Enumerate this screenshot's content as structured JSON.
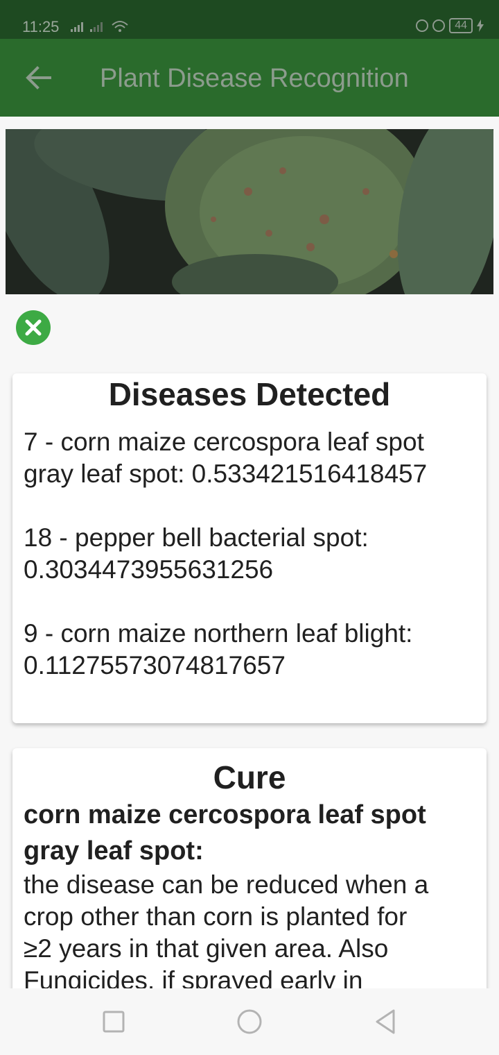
{
  "status_bar": {
    "time": "11:25",
    "battery": "44"
  },
  "app_bar": {
    "title": "Plant Disease Recognition"
  },
  "results_card": {
    "title": "Diseases Detected",
    "items": [
      {
        "line1": "7 - corn maize cercospora leaf spot",
        "line2": "gray leaf spot: 0.533421516418457"
      },
      {
        "line1": "18 - pepper bell bacterial spot:",
        "line2": "0.3034473955631256"
      },
      {
        "line1": "9 - corn maize northern leaf blight:",
        "line2": "0.11275573074817657"
      }
    ]
  },
  "cure_card": {
    "title": "Cure",
    "heading_line1": "corn maize cercospora leaf spot",
    "heading_line2": "gray leaf spot:",
    "text_lines": [
      "the disease can be reduced when a",
      "crop other than corn is planted for",
      "≥2 years in that given area. Also",
      "Fungicides, if sprayed early in"
    ]
  },
  "colors": {
    "status_bar": "#1e4a21",
    "app_bar": "#2a6b2c",
    "close_button": "#3daa44",
    "background": "#f7f7f7"
  },
  "icons": [
    "back-arrow-icon",
    "close-icon",
    "recents-icon",
    "home-icon",
    "back-triangle-icon"
  ]
}
